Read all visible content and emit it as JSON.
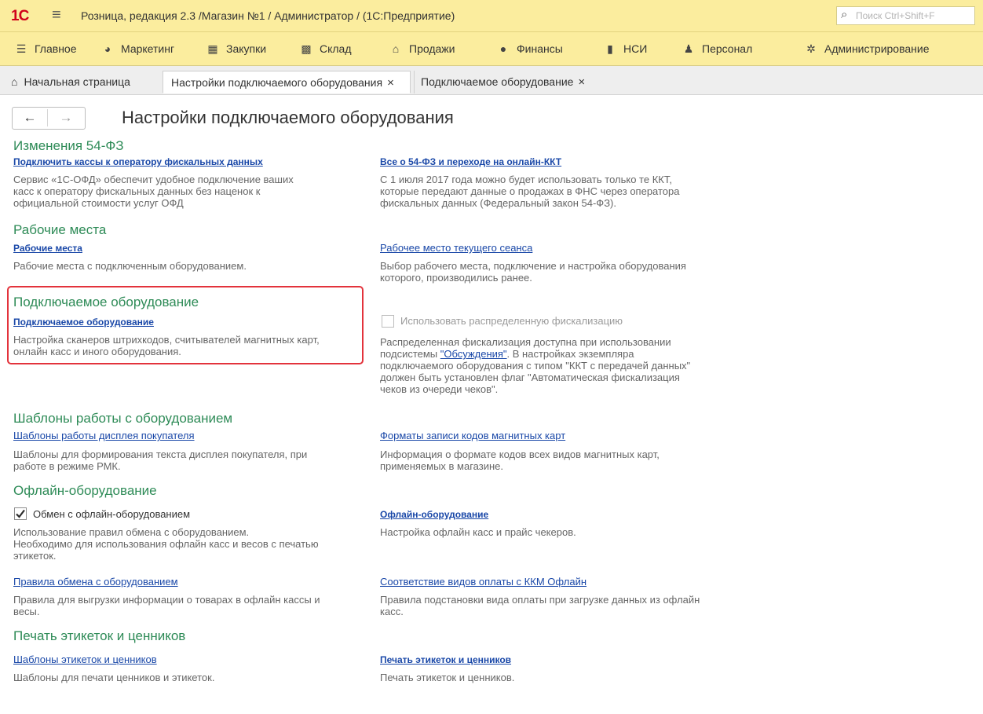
{
  "window": {
    "logo": "1С",
    "title": "Розница, редакция 2.3 /Магазин №1 / Администратор /  (1С:Предприятие)",
    "search_placeholder": "Поиск Ctrl+Shift+F"
  },
  "menu": [
    {
      "label": "Главное",
      "icon": "hamburger-icon"
    },
    {
      "label": "Маркетинг",
      "icon": "marketing-icon"
    },
    {
      "label": "Закупки",
      "icon": "purchases-icon"
    },
    {
      "label": "Склад",
      "icon": "warehouse-icon"
    },
    {
      "label": "Продажи",
      "icon": "sales-icon"
    },
    {
      "label": "Финансы",
      "icon": "finance-icon"
    },
    {
      "label": "НСИ",
      "icon": "reference-icon"
    },
    {
      "label": "Персонал",
      "icon": "person-icon"
    },
    {
      "label": "Администрирование",
      "icon": "gear-icon"
    }
  ],
  "tabs": [
    {
      "label": "Начальная страница",
      "icon": "home-icon"
    },
    {
      "label": "Настройки подключаемого оборудования",
      "close": "×"
    },
    {
      "label": "Подключаемое оборудование",
      "close": "×"
    }
  ],
  "nav": {
    "back": "←",
    "forward": "→"
  },
  "page": {
    "title": "Настройки подключаемого оборудования"
  },
  "sections": {
    "fz54": {
      "heading": "Изменения 54-ФЗ",
      "left_link": "Подключить кассы к оператору фискальных данных",
      "left_desc": [
        "Сервис «1С-ОФД» обеспечит удобное подключение ваших",
        "касс к оператору фискальных данных без наценок к",
        "официальной стоимости услуг ОФД"
      ],
      "right_link": "Все о 54-ФЗ и переходе на онлайн-ККТ",
      "right_desc": [
        "С 1 июля 2017 года можно будет использовать только те ККТ,",
        "которые передают данные о продажах в ФНС через оператора",
        "фискальных данных (Федеральный закон 54-ФЗ)."
      ]
    },
    "workplaces": {
      "heading": "Рабочие места",
      "left_link": "Рабочие места",
      "left_desc": [
        "Рабочие места с подключенным оборудованием."
      ],
      "right_link": "Рабочее место текущего сеанса",
      "right_desc": [
        "Выбор рабочего места, подключение и настройка оборудования",
        "которого, производились ранее."
      ]
    },
    "equipment": {
      "heading": "Подключаемое оборудование",
      "left_link": "Подключаемое оборудование",
      "left_desc": [
        "Настройка сканеров штрихкодов, считывателей магнитных карт,",
        "онлайн касс и иного оборудования."
      ],
      "checkbox_label": "Использовать распределенную фискализацию",
      "checkbox_checked": false,
      "right_desc_1": "Распределенная фискализация доступна при использовании",
      "right_desc_2_pre": "подсистемы ",
      "right_desc_2_link": "\"Обсуждения\"",
      "right_desc_2_post": ". В настройках экземпляра",
      "right_desc_rest": [
        "подключаемого оборудования с типом \"ККТ с передачей данных\"",
        "должен быть установлен флаг \"Автоматическая фискализация",
        "чеков из очереди чеков\"."
      ]
    },
    "templates": {
      "heading": "Шаблоны работы с оборудованием",
      "left_link": "Шаблоны работы дисплея покупателя",
      "left_desc": [
        "Шаблоны для формирования текста дисплея покупателя, при",
        "работе в режиме РМК."
      ],
      "right_link": "Форматы записи кодов магнитных карт",
      "right_desc": [
        "Информация о формате кодов всех видов магнитных карт,",
        "применяемых в магазине."
      ]
    },
    "offline": {
      "heading": "Офлайн-оборудование",
      "checkbox_label": "Обмен с офлайн-оборудованием",
      "checkbox_checked": true,
      "left_desc": [
        "Использование правил обмена с оборудованием.",
        "Необходимо для использования офлайн касс и весов с печатью",
        "этикеток."
      ],
      "right_link": "Офлайн-оборудование",
      "right_desc": [
        "Настройка офлайн касс и прайс чекеров."
      ],
      "left_link2": "Правила обмена с оборудованием",
      "left_desc2": [
        "Правила для выгрузки информации о товарах в офлайн кассы и",
        "весы."
      ],
      "right_link2": "Соответствие видов оплаты с ККМ Офлайн",
      "right_desc2": [
        "Правила подстановки вида оплаты при загрузке данных из офлайн",
        "касс."
      ]
    },
    "labels": {
      "heading": "Печать этикеток и ценников",
      "left_link": "Шаблоны этикеток и ценников",
      "left_desc": [
        "Шаблоны для печати ценников и этикеток."
      ],
      "right_link": "Печать этикеток и ценников",
      "right_desc": [
        "Печать этикеток и ценников."
      ]
    }
  },
  "colors": {
    "heading": "#2e8b57",
    "link": "#1a48a8",
    "bar": "#fbed9e",
    "highlight": "#e3333c"
  }
}
